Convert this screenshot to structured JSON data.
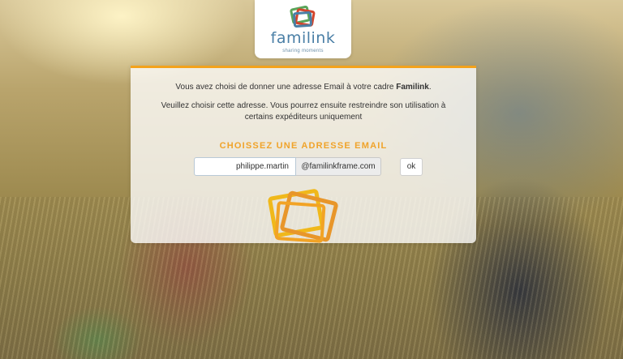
{
  "brand": {
    "name": "familink",
    "tagline": "sharing moments",
    "colors": {
      "blue": "#4a7fa6",
      "orange": "#f3a21b",
      "green": "#5aa55a",
      "red": "#d2452d"
    }
  },
  "panel": {
    "intro_prefix": "Vous avez choisi de donner une adresse Email à votre cadre ",
    "intro_brand": "Familink",
    "intro_suffix": ".",
    "instructions": "Veuillez choisir cette adresse. Vous pourrez ensuite restreindre son utilisation à certains expéditeurs uniquement",
    "headline": "CHOISSEZ UNE ADRESSE EMAIL",
    "email_input_value": "philippe.martin",
    "email_domain": "@familinkframe.com",
    "ok_label": "ok"
  },
  "icons": {
    "logo": "familink-frames-logo-icon",
    "watermark": "stacked-frames-icon"
  }
}
